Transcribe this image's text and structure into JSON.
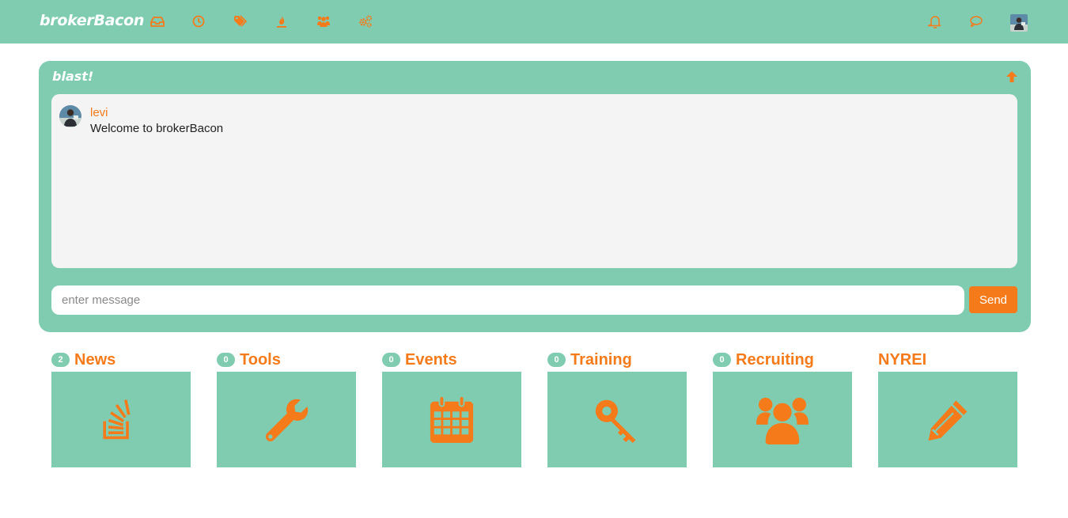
{
  "header": {
    "brand": "brokerBacon",
    "nav_icons": [
      "inbox-icon",
      "clock-icon",
      "tags-icon",
      "fire-icon",
      "group-icon",
      "cogs-icon"
    ],
    "right_icons": [
      "bell-icon",
      "chat-icon",
      "user-avatar"
    ]
  },
  "blast": {
    "title": "blast!",
    "messages": [
      {
        "user": "levi",
        "text": "Welcome to brokerBacon"
      }
    ],
    "input_placeholder": "enter message",
    "input_value": "",
    "send_label": "Send"
  },
  "tiles": [
    {
      "label": "News",
      "count": "2",
      "icon": "stack-overflow-icon"
    },
    {
      "label": "Tools",
      "count": "0",
      "icon": "wrench-icon"
    },
    {
      "label": "Events",
      "count": "0",
      "icon": "calendar-icon"
    },
    {
      "label": "Training",
      "count": "0",
      "icon": "key-icon"
    },
    {
      "label": "Recruiting",
      "count": "0",
      "icon": "users-icon"
    },
    {
      "label": "NYREI",
      "count": null,
      "icon": "pencil-icon"
    }
  ],
  "colors": {
    "teal": "#80ccb1",
    "orange": "#f57a1a",
    "message_bg": "#f4f4f4"
  }
}
